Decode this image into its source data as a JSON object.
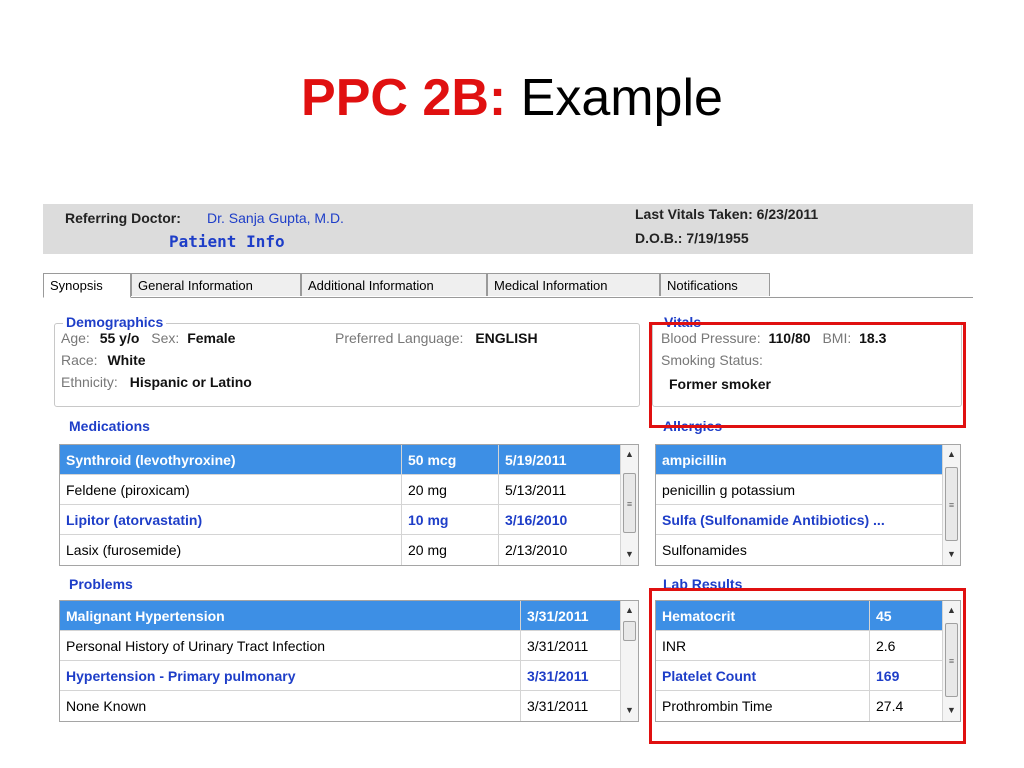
{
  "slide": {
    "title_highlight": "PPC 2B:",
    "title_rest": " Example"
  },
  "header": {
    "referring_label": "Referring Doctor:",
    "referring_value": "Dr. Sanja Gupta, M.D.",
    "patient_info": "Patient Info",
    "last_vitals": "Last Vitals Taken: 6/23/2011",
    "dob": "D.O.B.: 7/19/1955"
  },
  "tabs": [
    "Synopsis",
    "General Information",
    "Additional Information",
    "Medical Information",
    "Notifications"
  ],
  "demographics": {
    "title": "Demographics",
    "age_label": "Age:",
    "age_value": "55 y/o",
    "sex_label": "Sex:",
    "sex_value": "Female",
    "lang_label": "Preferred Language:",
    "lang_value": "ENGLISH",
    "race_label": "Race:",
    "race_value": "White",
    "eth_label": "Ethnicity:",
    "eth_value": "Hispanic or Latino"
  },
  "vitals": {
    "title": "Vitals",
    "bp_label": "Blood Pressure:",
    "bp_value": "110/80",
    "bmi_label": "BMI:",
    "bmi_value": "18.3",
    "smoking_label": "Smoking Status:",
    "smoking_value": "Former smoker"
  },
  "medications": {
    "title": "Medications",
    "rows": [
      [
        "Synthroid (levothyroxine)",
        "50 mcg",
        "5/19/2011"
      ],
      [
        "Feldene (piroxicam)",
        "20 mg",
        "5/13/2011"
      ],
      [
        "Lipitor (atorvastatin)",
        "10 mg",
        "3/16/2010"
      ],
      [
        "Lasix (furosemide)",
        "20 mg",
        "2/13/2010"
      ]
    ]
  },
  "allergies": {
    "title": "Allergies",
    "rows": [
      "ampicillin",
      "penicillin g potassium",
      "Sulfa (Sulfonamide Antibiotics) ...",
      "Sulfonamides"
    ]
  },
  "problems": {
    "title": "Problems",
    "rows": [
      [
        "Malignant Hypertension",
        "3/31/2011"
      ],
      [
        "Personal History of Urinary Tract Infection",
        "3/31/2011"
      ],
      [
        "Hypertension - Primary pulmonary",
        "3/31/2011"
      ],
      [
        "None Known",
        "3/31/2011"
      ]
    ]
  },
  "lab_results": {
    "title": "Lab Results",
    "rows": [
      [
        "Hematocrit",
        "45"
      ],
      [
        "INR",
        "2.6"
      ],
      [
        "Platelet Count",
        "169"
      ],
      [
        "Prothrombin Time",
        "27.4"
      ]
    ]
  },
  "icons": {
    "scroll_up": "▲",
    "scroll_down": "▼",
    "grip": "≡"
  },
  "colors": {
    "title_red": "#e01010",
    "link_blue": "#1e3ec8",
    "selection_blue": "#3d8fe5"
  }
}
